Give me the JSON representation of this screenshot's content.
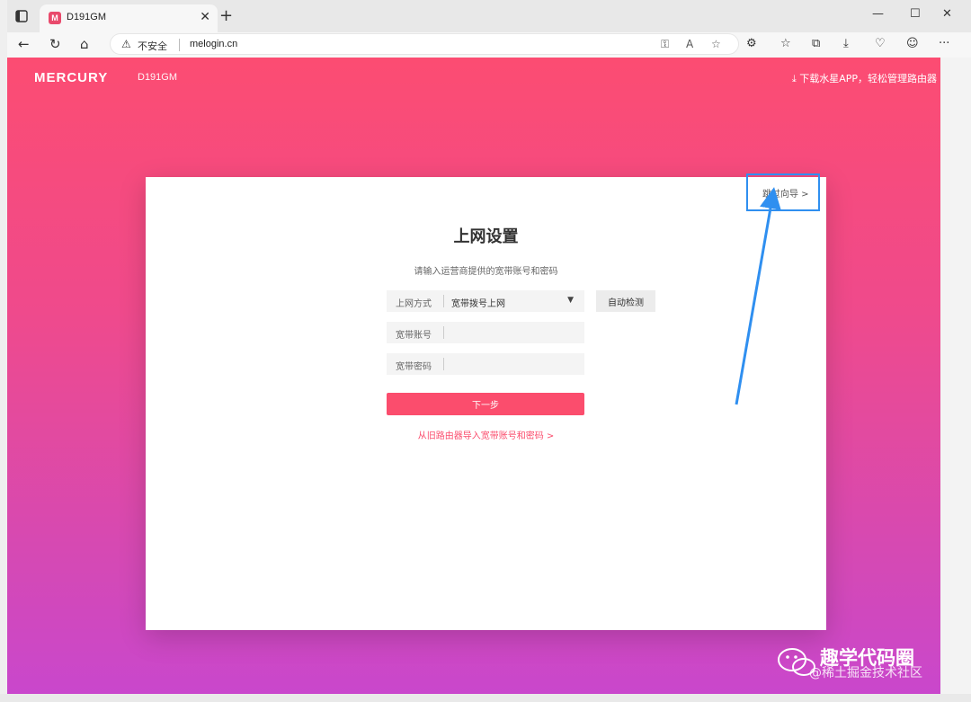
{
  "browser": {
    "tab_title": "D191GM",
    "favicon_letter": "M",
    "insecure_label": "不安全",
    "url": "melogin.cn"
  },
  "header": {
    "brand": "MERCURY",
    "model": "D191GM",
    "app_link": "下载水星APP，轻松管理路由器"
  },
  "card": {
    "skip_label": "跳过向导 >",
    "title": "上网设置",
    "subtitle": "请输入运营商提供的宽带账号和密码",
    "method_label": "上网方式",
    "method_value": "宽带拨号上网",
    "detect_button": "自动检测",
    "account_label": "宽带账号",
    "account_value": "",
    "password_label": "宽带密码",
    "password_value": "",
    "next_button": "下一步",
    "import_link": "从旧路由器导入宽带账号和密码 >"
  },
  "watermark": {
    "title": "趣学代码圈",
    "sub": "@稀土掘金技术社区"
  },
  "colors": {
    "accent": "#fb4d6d",
    "highlight_box": "#2f8ff0"
  }
}
